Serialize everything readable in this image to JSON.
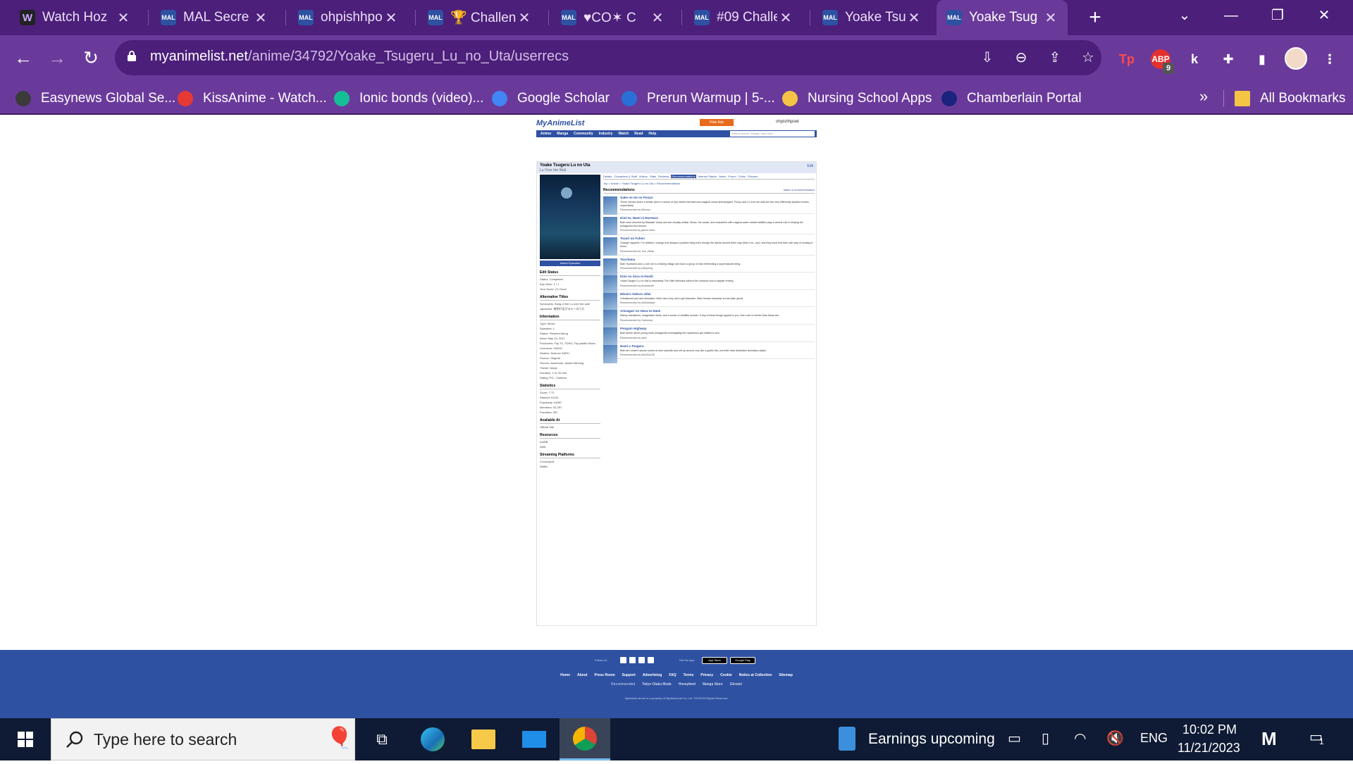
{
  "browser": {
    "tabs": [
      {
        "icon": "W",
        "title": "Watch Hoz",
        "active": false
      },
      {
        "icon": "MAL",
        "title": "MAL Secre",
        "active": false
      },
      {
        "icon": "MAL",
        "title": "ohpishhpo",
        "active": false
      },
      {
        "icon": "MAL",
        "title": "🏆 Challen",
        "active": false
      },
      {
        "icon": "MAL",
        "title": "♥CO✶ C",
        "active": false
      },
      {
        "icon": "MAL",
        "title": "#09 Challe",
        "active": false
      },
      {
        "icon": "MAL",
        "title": "Yoake Tsug",
        "active": false
      },
      {
        "icon": "MAL",
        "title": "Yoake Tsug",
        "active": true
      }
    ],
    "close_glyph": "✕",
    "new_tab_glyph": "+",
    "url_host": "myanimelist.net",
    "url_path": "/anime/34792/Yoake_Tsugeru_Lu_no_Uta/userrecs",
    "extensions": [
      {
        "label": "ABP",
        "badge": "9",
        "color": "#e3312d"
      },
      {
        "label": "k",
        "color": "#7b3fe4"
      }
    ],
    "bookmarks": [
      {
        "label": "Easynews Global Se...",
        "color": "#3a3a3a"
      },
      {
        "label": "KissAnime - Watch...",
        "color": "#e53935"
      },
      {
        "label": "Ionic bonds (video)...",
        "color": "#14bf96"
      },
      {
        "label": "Google Scholar",
        "color": "#4285f4"
      },
      {
        "label": "Prerun Warmup | 5-...",
        "color": "#2a6fd6"
      },
      {
        "label": "Nursing School Apps",
        "color": "#f6c445"
      },
      {
        "label": "Chamberlain Portal",
        "color": "#1a237e"
      }
    ],
    "bookmarks_more": "»",
    "all_bookmarks": "All Bookmarks"
  },
  "mal": {
    "logo": "MyAnimeList",
    "hide_ads": "Hide Ads",
    "username": "ohpishhpoet",
    "nav": [
      "Anime",
      "Manga",
      "Community",
      "Industry",
      "Watch",
      "Read",
      "Help"
    ],
    "search_placeholder": "Search Anime, Manga, and more...",
    "title_main": "Yoake Tsugeru Lu no Uta",
    "title_en": "Lu Over the Wall",
    "edit": "Edit",
    "watch_episodes": "Watch Episodes",
    "sidebar": [
      {
        "heading": "Edit Status",
        "lines": [
          "Status: Completed",
          "Eps Seen: 1 / 1",
          "Your Score: (7) Good"
        ]
      },
      {
        "heading": "Alternative Titles",
        "lines": [
          "Synonyms: Song of the Lu over the wall",
          "Japanese: 夜明け告げるルーのうた"
        ]
      },
      {
        "heading": "Information",
        "lines": [
          "Type: Movie",
          "Episodes: 1",
          "Status: Finished Airing",
          "Aired: May 19, 2017",
          "Producers: Fuji TV, TOHO, Fuji pacific Music",
          "Licensors: GKIDS",
          "Studios: Science SARU",
          "Source: Original",
          "Genres: Adventure, Award Winning",
          "Theme: Music",
          "Duration: 1 hr. 52 min.",
          "Rating: PG - Children"
        ]
      },
      {
        "heading": "Statistics",
        "lines": [
          "Score: 7.72",
          "Ranked: #1011",
          "Popularity: #1897",
          "Members: 92,297",
          "Favorites: 397"
        ]
      },
      {
        "heading": "Available At",
        "lines": [
          "Official Site"
        ]
      },
      {
        "heading": "Resources",
        "lines": [
          "AniDB",
          "ANN"
        ]
      },
      {
        "heading": "Streaming Platforms",
        "lines": [
          "Crunchyroll",
          "Netflix"
        ]
      }
    ],
    "subtabs": [
      "Details",
      "Characters & Staff",
      "Videos",
      "Stats",
      "Reviews",
      "Recommendations",
      "Interest Stacks",
      "News",
      "Forum",
      "Clubs",
      "Pictures"
    ],
    "selected_subtab": "Recommendations",
    "breadcrumb": "Top > Anime > Yoake Tsugeru Lu no Uta > Recommendations",
    "rec_heading": "Recommendations",
    "make_rec": "Make a recommendation",
    "recs": [
      {
        "title": "Gake no Ue no Ponyo",
        "text": "These movies share a similar plot in a sense of boy meets mermaid and magical ocean shenanigans. Ponyo and Lu over the wall are two very differently stylized movies respectively.",
        "by": "Recommended by Mimoso"
      },
      {
        "title": "Kimi to, Nami ni Noretara",
        "text": "Both were directed by Masaaki Yuasa and are visually similar. Music, the ocean, and characters with magical water-related abilities play a central role in helping the protagonist find closure.",
        "by": "Recommended by gamer-lamb"
      },
      {
        "title": "Tsuuri no Fuhen",
        "text": "Change happens. For children, change isn't always a positive thing even though the adults around them may think it so—and, and they must find their own way of coming to terms.",
        "by": "Recommended by Tom_Hikari"
      },
      {
        "title": "Tsuritama",
        "text": "Both Tsuritama and Lu are set in a fishing village and have a group of kids befriending a supernatural being.",
        "by": "Recommended by kickyeeng"
      },
      {
        "title": "Kimi no Sora ni Hoshi",
        "text": "Yoake Tsugeru Lu no Uta is essentially The Little Mermaid without the romance and a happier ending.",
        "by": "Recommended by thomaskoff"
      },
      {
        "title": "Mizuiro Sakura Jidai",
        "text": "Unbalanced plot and animation. Both star a boy and a girl character. Main female character is mermaid, ghost.",
        "by": "Recommended by ufoblackstar"
      },
      {
        "title": "Ameagari no Hana to Nami",
        "text": "Wacky animations, imaginative ideas, and a sense of childlike wonder. If any of these things appeal to you, then rush to further than these two.",
        "by": "Recommended by Galvuniza"
      },
      {
        "title": "Penguin Highway",
        "text": "Both anime about young male protagonist investigating the mysterious girl related to sea.",
        "by": "Recommended by sjtdu"
      },
      {
        "title": "Nami o Tsugeru",
        "text": "Both are movie's whose stories is shot episodic and set up around very like a goblin film, but their have distinctive animation styles.",
        "by": "Recommended by Moe2Kor35"
      }
    ],
    "footer": {
      "follow_us": "Follow Us",
      "get_app": "Get the App",
      "app_store": "App Store",
      "google_play": "Google Play",
      "links": [
        "Home",
        "About",
        "Press Room",
        "Support",
        "Advertising",
        "FAQ",
        "Terms",
        "Privacy",
        "Cookie",
        "Notice at Collection",
        "Sitemap"
      ],
      "recommended": "Recommended",
      "partners": [
        "Tokyo Otaku Mode",
        "Honeyfeed",
        "Manga Store",
        "Ghostel"
      ],
      "copyright": "MyAnimeList.net is a property of MyAnimeList Co.,Ltd. ©2023 All Rights Reserved."
    }
  },
  "taskbar": {
    "search_placeholder": "Type here to search",
    "earnings": "Earnings upcoming",
    "language": "ENG",
    "time": "10:02 PM",
    "date": "11/21/2023",
    "notifications": "1"
  }
}
